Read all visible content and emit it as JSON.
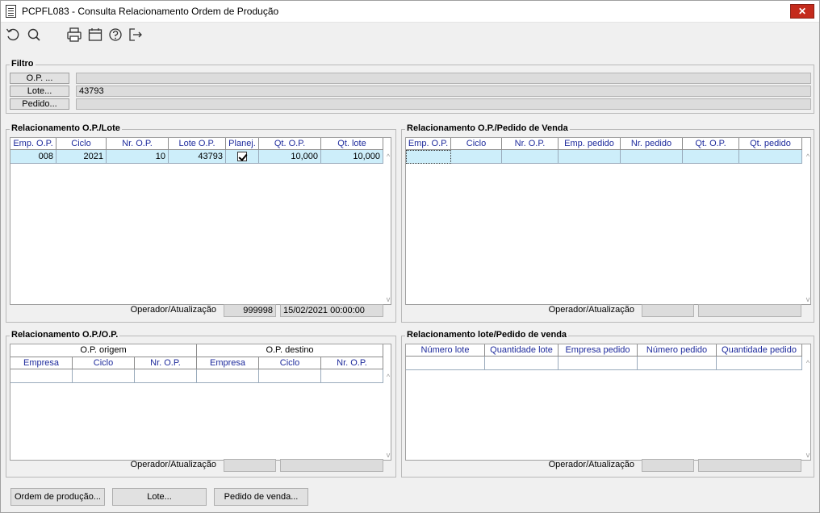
{
  "window": {
    "title": "PCPFL083 - Consulta Relacionamento Ordem de Produção",
    "close_label": "✕"
  },
  "toolbar": {
    "icons": [
      "refresh-icon",
      "search-icon",
      "print-icon",
      "calendar-icon",
      "help-icon",
      "exit-icon"
    ]
  },
  "filter": {
    "title": "Filtro",
    "op_label": "O.P. ...",
    "op_value": "",
    "lote_label": "Lote...",
    "lote_value": "43793",
    "pedido_label": "Pedido...",
    "pedido_value": ""
  },
  "op_lote": {
    "title": "Relacionamento O.P./Lote",
    "columns": [
      "Emp. O.P.",
      "Ciclo",
      "Nr. O.P.",
      "Lote O.P.",
      "Planej.",
      "Qt. O.P.",
      "Qt. lote"
    ],
    "rows": [
      {
        "emp": "008",
        "ciclo": "2021",
        "nr_op": "10",
        "lote_op": "43793",
        "planej": true,
        "qt_op": "10,000",
        "qt_lote": "10,000"
      }
    ],
    "operator_label": "Operador/Atualização",
    "operator_value": "999998",
    "date_value": "15/02/2021 00:00:00"
  },
  "op_pedido": {
    "title": "Relacionamento O.P./Pedido de Venda",
    "columns": [
      "Emp. O.P.",
      "Ciclo",
      "Nr. O.P.",
      "Emp. pedido",
      "Nr. pedido",
      "Qt. O.P.",
      "Qt. pedido"
    ],
    "operator_label": "Operador/Atualização",
    "operator_value": "",
    "date_value": ""
  },
  "op_op": {
    "title": "Relacionamento O.P./O.P.",
    "group_origem": "O.P. origem",
    "group_destino": "O.P. destino",
    "columns": [
      "Empresa",
      "Ciclo",
      "Nr. O.P.",
      "Empresa",
      "Ciclo",
      "Nr. O.P."
    ],
    "operator_label": "Operador/Atualização",
    "operator_value": "",
    "date_value": ""
  },
  "lote_pedido": {
    "title": "Relacionamento lote/Pedido de venda",
    "columns": [
      "Número lote",
      "Quantidade lote",
      "Empresa pedido",
      "Número pedido",
      "Quantidade pedido"
    ],
    "operator_label": "Operador/Atualização",
    "operator_value": "",
    "date_value": ""
  },
  "footer": {
    "ordem_label": "Ordem de produção...",
    "lote_label": "Lote...",
    "pedido_label": "Pedido de venda..."
  }
}
